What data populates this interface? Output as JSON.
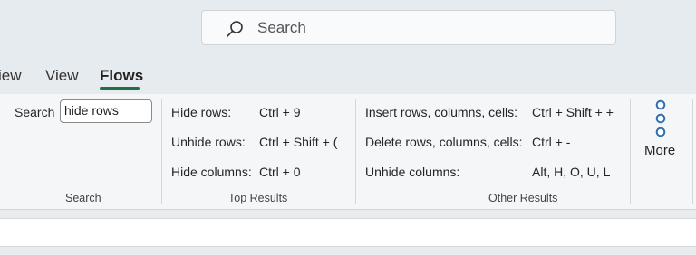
{
  "search": {
    "placeholder": "Search"
  },
  "tabs": [
    {
      "label": "iew"
    },
    {
      "label": "View"
    },
    {
      "label": "Flows"
    }
  ],
  "ribbon": {
    "search_group": {
      "label": "Search",
      "input_value": "hide rows",
      "group_label": "Search"
    },
    "top_results": {
      "group_label": "Top Results",
      "items": [
        {
          "label": "Hide rows:",
          "shortcut": "Ctrl + 9"
        },
        {
          "label": "Unhide rows:",
          "shortcut": "Ctrl + Shift + ("
        },
        {
          "label": "Hide columns:",
          "shortcut": "Ctrl + 0"
        }
      ]
    },
    "other_results": {
      "group_label": "Other Results",
      "items": [
        {
          "label": "Insert rows, columns, cells:",
          "shortcut": "Ctrl + Shift + +"
        },
        {
          "label": "Delete rows, columns, cells:",
          "shortcut": "Ctrl + -"
        },
        {
          "label": "Unhide columns:",
          "shortcut": "Alt, H, O, U, L"
        }
      ]
    },
    "more_label": "More"
  },
  "colors": {
    "accent": "#1e7145",
    "more_dots": "#2f6fb0"
  }
}
